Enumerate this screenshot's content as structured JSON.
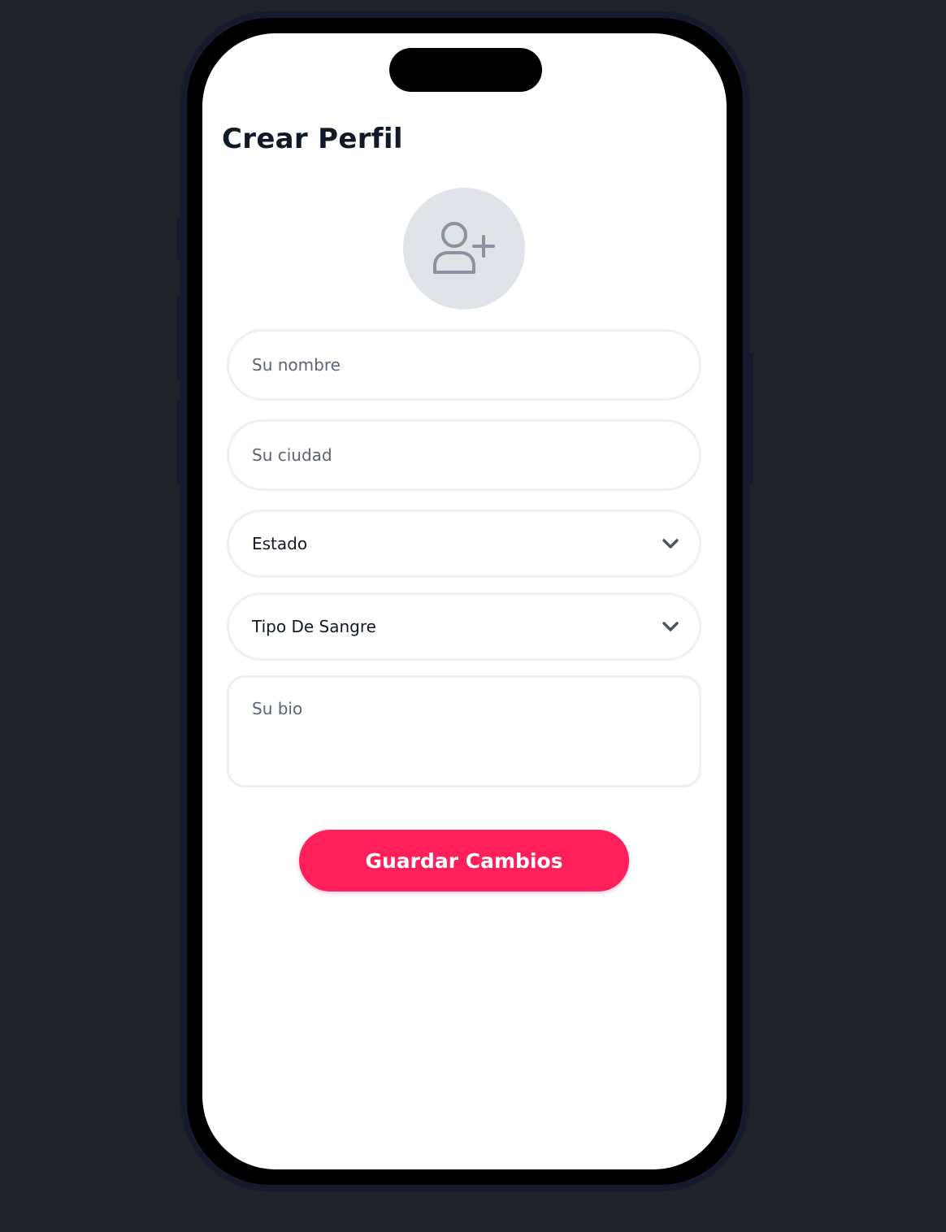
{
  "screen": {
    "title": "Crear Perfil"
  },
  "avatar": {
    "icon": "user-plus-icon"
  },
  "form": {
    "name_placeholder": "Su nombre",
    "city_placeholder": "Su ciudad",
    "state_label": "Estado",
    "blood_type_label": "Tipo De Sangre",
    "bio_placeholder": "Su bio"
  },
  "actions": {
    "save_label": "Guardar Cambios"
  },
  "colors": {
    "accent": "#ff1f5a",
    "background": "#1f2329",
    "avatar_bg": "#e0e3e8",
    "icon_gray": "#8a939f"
  }
}
